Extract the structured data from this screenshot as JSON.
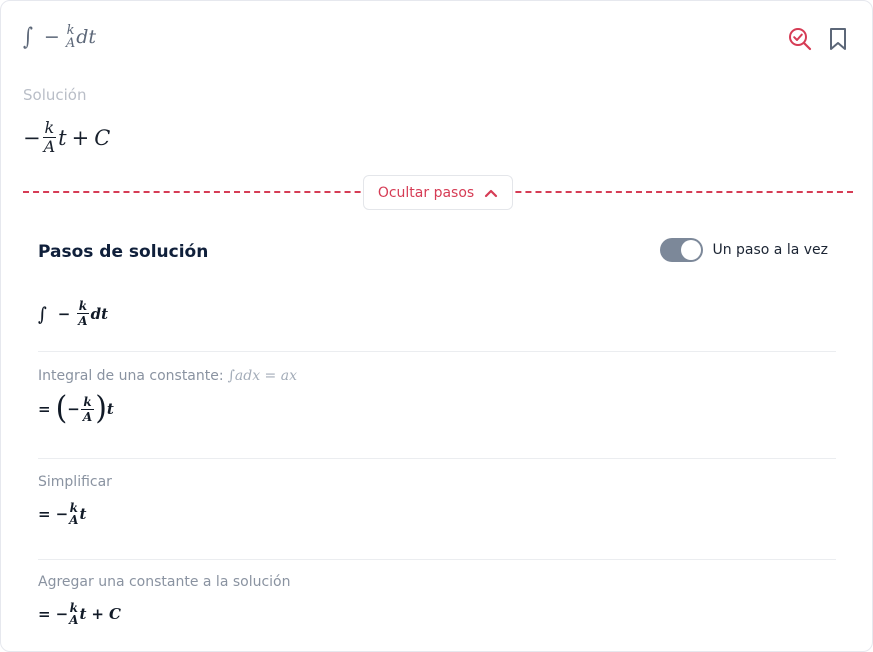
{
  "header": {
    "problem": {
      "int": "∫",
      "minus": "−",
      "num": "k",
      "den": "A",
      "dt": "dt"
    },
    "icons": [
      "check-search-icon",
      "bookmark-icon"
    ]
  },
  "solution": {
    "label": "Solución",
    "expr": {
      "minus": "−",
      "num": "k",
      "den": "A",
      "t": "t",
      "plus": "+",
      "c": "C"
    }
  },
  "hide_steps_label": "Ocultar pasos",
  "steps_panel": {
    "title": "Pasos de solución",
    "toggle_label": "Un paso a la vez",
    "toggle_on": true
  },
  "steps": {
    "s0": {
      "int": "∫",
      "minus": "−",
      "num": "k",
      "den": "A",
      "dt": "dt"
    },
    "s1": {
      "desc": "Integral de una constante:",
      "rule": "∫adx = ax",
      "eq": "=",
      "lp": "(",
      "minus": "−",
      "num": "k",
      "den": "A",
      "rp": ")",
      "t": "t"
    },
    "s2": {
      "desc": "Simplificar",
      "eq": "=",
      "minus": "−",
      "num": "k",
      "den": "A",
      "t": "t"
    },
    "s3": {
      "desc": "Agregar una constante a la solución",
      "eq": "=",
      "minus": "−",
      "num": "k",
      "den": "A",
      "t": "t",
      "plus": "+",
      "c": "C"
    }
  },
  "colors": {
    "accent": "#d63c55",
    "toggle": "#7c8899",
    "title": "#0f1f3a"
  }
}
